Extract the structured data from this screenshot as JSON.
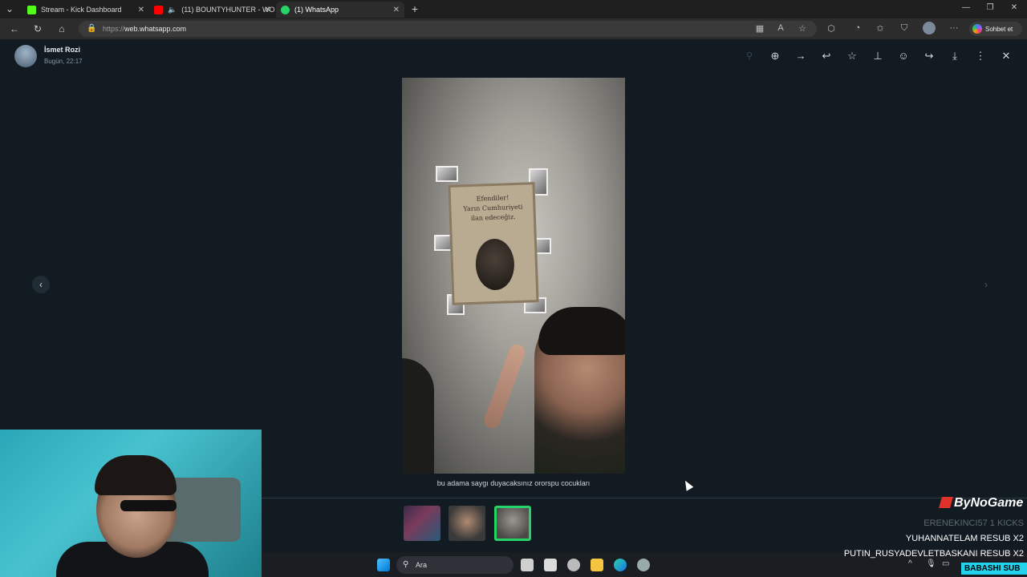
{
  "browser": {
    "tabs": [
      {
        "title": "Stream - Kick Dashboard",
        "favicon_color": "#53fc18"
      },
      {
        "title": "(11) BOUNTYHUNTER - WO",
        "favicon_color": "#ff0000"
      },
      {
        "title": "(1) WhatsApp",
        "favicon_color": "#25d366"
      }
    ],
    "active_tab_index": 2,
    "url_scheme": "https://",
    "url_host": "web.whatsapp.com",
    "copilot_label": "Sohbet et"
  },
  "viewer": {
    "sender_name": "İsmet Rozi",
    "timestamp": "Bugün, 22:17",
    "caption": "bu adama saygı duyacaksınız ororspu cocukları",
    "poster_text": "Efendiler!\nYarın Cumhuriyeti\nilan edeceğiz.",
    "toolbar_icons": [
      "zoom-in-icon",
      "forward-arrow-icon",
      "reply-icon",
      "star-icon",
      "pin-icon",
      "emoji-icon",
      "share-icon",
      "download-icon",
      "more-icon",
      "close-icon"
    ]
  },
  "taskbar": {
    "search_placeholder": "Ara"
  },
  "stream_overlay": {
    "brand": "ByNoGame",
    "events": [
      {
        "text": "ERENEKINCI57   1 KICKS",
        "dim": true
      },
      {
        "text": "YUHANNATELAM   RESUB X2",
        "dim": false
      },
      {
        "text": "PUTIN_RUSYADEVLETBASKANI   RESUB X2",
        "dim": false
      }
    ],
    "sub_badge": "BABASHI  SUB"
  },
  "colors": {
    "accent": "#25d366",
    "bg": "#111b21"
  }
}
